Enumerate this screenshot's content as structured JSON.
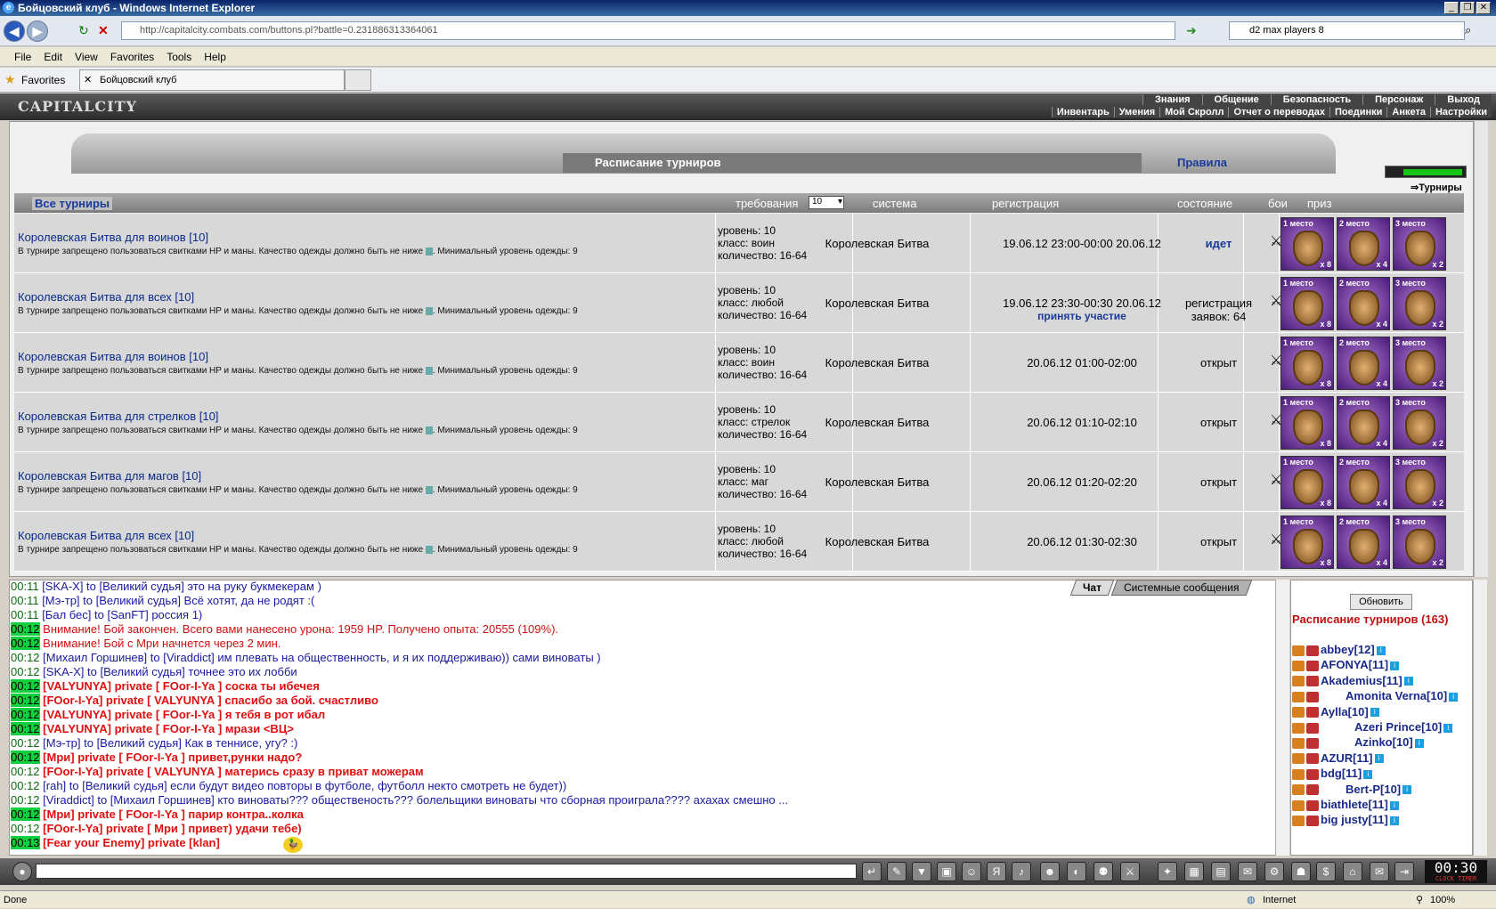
{
  "window": {
    "title": "Бойцовский клуб - Windows Internet Explorer"
  },
  "addressbar": {
    "url": "http://capitalcity.combats.com/buttons.pl?battle=0.231886313364061",
    "search": "d2 max players 8"
  },
  "menu": [
    "File",
    "Edit",
    "View",
    "Favorites",
    "Tools",
    "Help"
  ],
  "favorites": {
    "label": "Favorites",
    "tab": "Бойцовский клуб"
  },
  "game": {
    "logo": "CAPITALCITY",
    "topmenu1": [
      "Знания",
      "Общение",
      "Безопасность",
      "Персонаж",
      "Выход"
    ],
    "topmenu2": [
      "Инвентарь",
      "Умения",
      "Мой Скролл",
      "Отчет о переводах",
      "Поединки",
      "Анкета",
      "Настройки"
    ],
    "banner_title": "Расписание турниров",
    "rules": "Правила",
    "tournaments_link": "Турниры"
  },
  "table": {
    "headers": {
      "all": "Все турниры",
      "req": "требования",
      "req_select": "10",
      "system": "система",
      "registration": "регистрация",
      "state": "состояние",
      "fights": "бои",
      "prize": "приз"
    },
    "desc": "В турнире запрещено пользоваться свитками HP и маны. Качество одежды должно быть не ниже",
    "desc2": ". Минимальный уровень одежды: 9",
    "prize_labels": [
      "1 место",
      "2 место",
      "3 место"
    ],
    "prize_counts": [
      "x 8",
      "x 4",
      "x 2"
    ],
    "rows": [
      {
        "name": "Королевская Битва для воинов [10]",
        "level": "уровень: 10",
        "cls": "класс: воин",
        "qty": "количество: 16-64",
        "system": "Королевская Битва",
        "reg": "19.06.12 23:00-00:00 20.06.12",
        "reg_link": "",
        "state": "идет",
        "state2": ""
      },
      {
        "name": "Королевская Битва для всех [10]",
        "level": "уровень: 10",
        "cls": "класс: любой",
        "qty": "количество: 16-64",
        "system": "Королевская Битва",
        "reg": "19.06.12 23:30-00:30 20.06.12",
        "reg_link": "принять участие",
        "state": "регистрация",
        "state2": "заявок: 64"
      },
      {
        "name": "Королевская Битва для воинов [10]",
        "level": "уровень: 10",
        "cls": "класс: воин",
        "qty": "количество: 16-64",
        "system": "Королевская Битва",
        "reg": "20.06.12 01:00-02:00",
        "reg_link": "",
        "state": "открыт",
        "state2": ""
      },
      {
        "name": "Королевская Битва для стрелков [10]",
        "level": "уровень: 10",
        "cls": "класс: стрелок",
        "qty": "количество: 16-64",
        "system": "Королевская Битва",
        "reg": "20.06.12 01:10-02:10",
        "reg_link": "",
        "state": "открыт",
        "state2": ""
      },
      {
        "name": "Королевская Битва для магов [10]",
        "level": "уровень: 10",
        "cls": "класс: маг",
        "qty": "количество: 16-64",
        "system": "Королевская Битва",
        "reg": "20.06.12 01:20-02:20",
        "reg_link": "",
        "state": "открыт",
        "state2": ""
      },
      {
        "name": "Королевская Битва для всех [10]",
        "level": "уровень: 10",
        "cls": "класс: любой",
        "qty": "количество: 16-64",
        "system": "Королевская Битва",
        "reg": "20.06.12 01:30-02:30",
        "reg_link": "",
        "state": "открыт",
        "state2": ""
      }
    ]
  },
  "chat": {
    "tabs": [
      "Чат",
      "Системные сообщения"
    ],
    "lines": [
      "00:11 [SKA-X] to [Великий судья] это на руку букмекерам )",
      "00:11 [Мэ-тр] to [Великий судья] Всё хотят, да не родят :(",
      "00:11 [Бал бес] to [SanFT] россия 1)",
      "00:12 Внимание! Бой закончен. Всего вами нанесено урона: 1959 HP. Получено опыта: 20555 (109%).",
      "00:12 Внимание! Бой с Мри начнется через 2 мин.",
      "00:12 [Михаил Горшинев] to [Viraddict] им плевать на общественность, и я их поддерживаю)) сами виноваты )",
      "00:12 [SKA-X] to [Великий судья] точнее это их лобби",
      "00:12 [VALYUNYA] private [ FOor-I-Ya ] соска ты ибечея",
      "00:12 [FOor-I-Ya] private [ VALYUNYA ] спасибо за бой. счастливо",
      "00:12 [VALYUNYA] private [ FOor-I-Ya ] я тебя в рот ибал",
      "00:12 [VALYUNYA] private [ FOor-I-Ya ] мрази <ВЦ>",
      "00:12 [Мэ-тр] to [Великий судья] Как в теннисе, угу? :)",
      "00:12 [Мри] private [ FOor-I-Ya ] привет,рунки надо?",
      "00:12 [FOor-I-Ya] private [ VALYUNYA ] матерись сразу в приват можерам",
      "00:12 [rah] to [Великий судья] если будут видео повторы в футболе, футболл некто смотреть не будет))",
      "00:12 [Viraddict] to [Михаил Горшинев] кто виноваты??? общественость??? болельщики виноваты что сборная проиграла???? ахахах смешно ...",
      "00:12 [Мри] private [ FOor-I-Ya ] парир контра..колка",
      "00:12 [FOor-I-Ya] private [ Мри ] привет) удачи тебе)",
      "00:13 [Fear your Enemy] private [klan]"
    ]
  },
  "rightpanel": {
    "refresh": "Обновить",
    "title": "Расписание турниров (163)",
    "players": [
      "abbey[12]",
      "AFONYA[11]",
      "Akademius[11]",
      "Amonita Verna[10]",
      "Aylla[10]",
      "Azeri Prince[10]",
      "Azinko[10]",
      "AZUR[11]",
      "bdg[11]",
      "Bert-P[10]",
      "biathlete[11]",
      "big justy[11]"
    ]
  },
  "clock": {
    "time": "00:30",
    "label": "CLOCK TIMER"
  },
  "statusbar": {
    "left": "Done",
    "zone": "Internet",
    "zoom": "100%"
  }
}
